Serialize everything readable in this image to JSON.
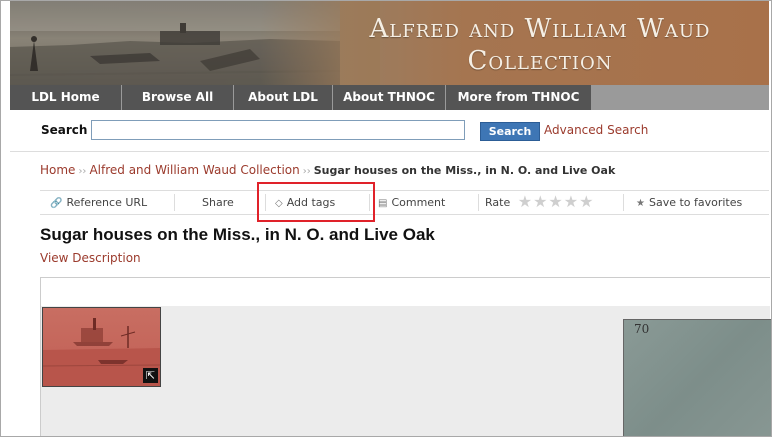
{
  "banner": {
    "title": "Alfred and William Waud Collection",
    "title_line1": "Alfred and William Waud",
    "title_line2": "Collection"
  },
  "nav": {
    "items": [
      "LDL Home",
      "Browse All",
      "About LDL",
      "About THNOC",
      "More from THNOC"
    ]
  },
  "search": {
    "label": "Search",
    "value": "",
    "button": "Search",
    "advanced": "Advanced Search"
  },
  "breadcrumb": {
    "home": "Home",
    "collection": "Alfred and William Waud Collection",
    "current": "Sugar houses on the Miss., in N. O. and Live Oak",
    "separator": "››"
  },
  "toolbar": {
    "reference_url": "Reference URL",
    "share": "Share",
    "add_tags": "Add tags",
    "comment": "Comment",
    "rate": "Rate",
    "rating_stars": 0,
    "rating_max": 5,
    "save": "Save to favorites"
  },
  "item": {
    "title": "Sugar houses on the Miss., in N. O. and Live Oak",
    "view_description": "View Description",
    "scan_mark": "70"
  },
  "colors": {
    "nav_bg": "#545454",
    "link": "#9b3a2c",
    "search_button": "#3e76b5",
    "highlight": "#e0222a",
    "thumbnail": "#c4655a"
  },
  "icons": {
    "reference_url": "link-icon",
    "add_tags": "tag-icon",
    "comment": "comment-icon",
    "save": "star-icon",
    "expand": "expand-arrow-icon"
  }
}
